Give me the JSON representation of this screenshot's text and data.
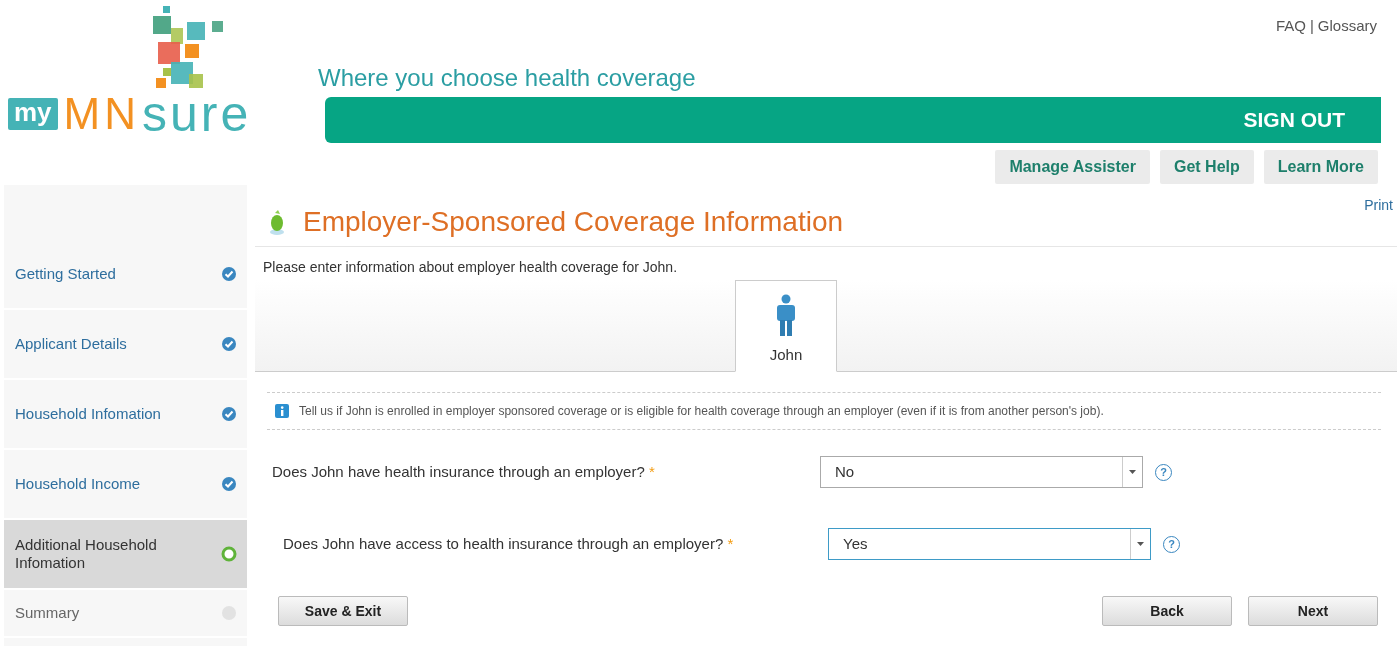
{
  "logo": {
    "my": "my",
    "mn": "MN",
    "sure": "sure"
  },
  "tagline": "Where you choose health coverage",
  "top_links": {
    "links": [
      "FAQ",
      "Glossary"
    ],
    "separator": "|"
  },
  "sign_out": "SIGN OUT",
  "header_buttons": [
    "Manage Assister",
    "Get Help",
    "Learn More"
  ],
  "sidebar": {
    "items": [
      {
        "label": "Getting Started",
        "kind": "done",
        "selected": false
      },
      {
        "label": "Applicant Details",
        "kind": "done",
        "selected": false
      },
      {
        "label": "Household Infomation",
        "kind": "done",
        "selected": false
      },
      {
        "label": "Household Income",
        "kind": "done",
        "selected": false
      },
      {
        "label": "Additional Household Infomation",
        "kind": "current",
        "selected": true
      },
      {
        "label": "Summary",
        "kind": "pending",
        "selected": false
      }
    ]
  },
  "page_title": "Employer-Sponsored Coverage Information",
  "print": "Print",
  "intro": "Please enter information about employer health coverage for John.",
  "person_tabs": [
    {
      "label": "John",
      "selected": true
    }
  ],
  "info": "Tell us if John is enrolled in employer sponsored coverage or is eligible for health coverage through an employer (even if it is from another person's job).",
  "questions": [
    {
      "label": "Does John have health insurance through an employer?",
      "required_mark": "*",
      "value": "No",
      "focused": false,
      "help": "?"
    },
    {
      "label": "Does John have access to health insurance through an employer?",
      "required_mark": "*",
      "value": "Yes",
      "focused": true,
      "help": "?"
    }
  ],
  "buttons": {
    "left": [
      "Save & Exit"
    ],
    "right": [
      "Back",
      "Next"
    ]
  }
}
